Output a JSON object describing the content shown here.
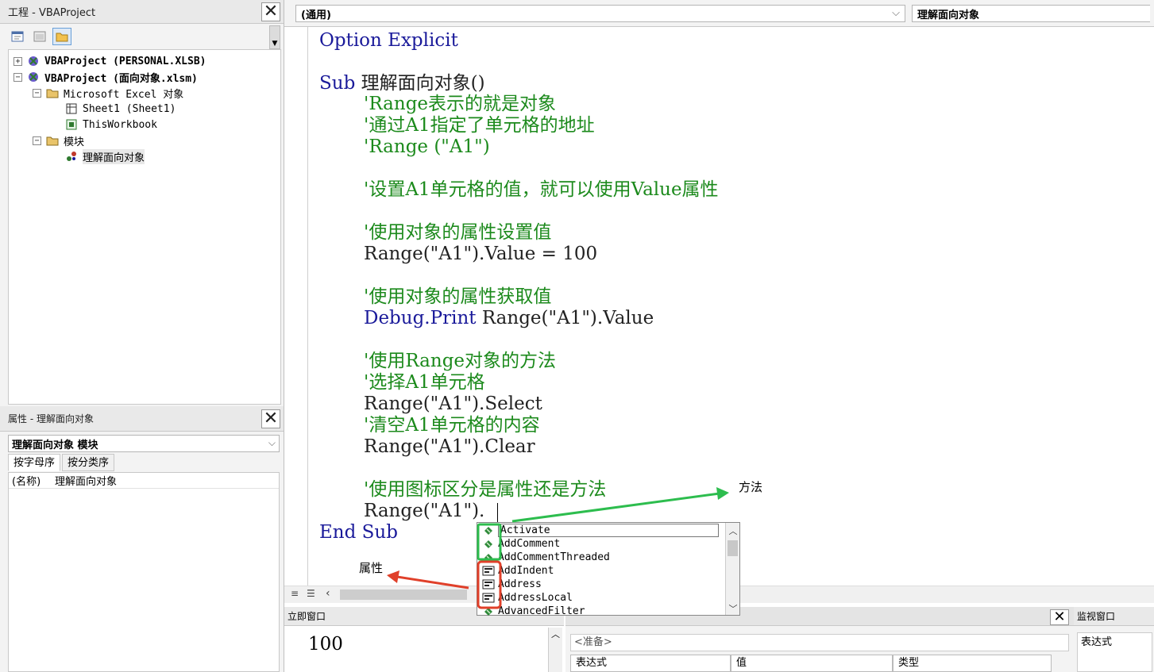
{
  "project_pane": {
    "title": "工程 - VBAProject",
    "tree": [
      {
        "label": "VBAProject (PERSONAL.XLSB)",
        "expander": "+",
        "bold": true
      },
      {
        "label": "VBAProject (面向对象.xlsm)",
        "expander": "−",
        "bold": true
      },
      {
        "label": "Microsoft Excel 对象",
        "expander": "−",
        "bold": false
      },
      {
        "label": "Sheet1 (Sheet1)",
        "expander": "",
        "bold": false
      },
      {
        "label": "ThisWorkbook",
        "expander": "",
        "bold": false
      },
      {
        "label": "模块",
        "expander": "−",
        "bold": false
      },
      {
        "label": "理解面向对象",
        "expander": "",
        "bold": false
      }
    ]
  },
  "properties_pane": {
    "title": "属性 - 理解面向对象",
    "object_select": "理解面向对象 模块",
    "tabs": [
      "按字母序",
      "按分类序"
    ],
    "rows": [
      {
        "name": "(名称)",
        "value": "理解面向对象"
      }
    ]
  },
  "code_window": {
    "object_dropdown": "(通用)",
    "procedure_dropdown": "理解面向对象",
    "lines": [
      {
        "text": "Option Explicit",
        "style": "kw"
      },
      {
        "text": "",
        "style": "tx"
      },
      {
        "text": "Sub 理解面向对象()",
        "style": "mix_sub"
      },
      {
        "text": "    'Range表示的就是对象",
        "style": "cm"
      },
      {
        "text": "    '通过A1指定了单元格的地址",
        "style": "cm"
      },
      {
        "text": "    'Range (\"A1\")",
        "style": "cm"
      },
      {
        "text": "",
        "style": "tx"
      },
      {
        "text": "    '设置A1单元格的值，就可以使用Value属性",
        "style": "cm"
      },
      {
        "text": "",
        "style": "tx"
      },
      {
        "text": "    '使用对象的属性设置值",
        "style": "cm"
      },
      {
        "text": "    Range(\"A1\").Value = 100",
        "style": "tx"
      },
      {
        "text": "",
        "style": "tx"
      },
      {
        "text": "    '使用对象的属性获取值",
        "style": "cm"
      },
      {
        "text": "    Debug.Print Range(\"A1\").Value",
        "style": "mix_debug"
      },
      {
        "text": "",
        "style": "tx"
      },
      {
        "text": "    '使用Range对象的方法",
        "style": "cm"
      },
      {
        "text": "    '选择A1单元格",
        "style": "cm"
      },
      {
        "text": "    Range(\"A1\").Select",
        "style": "tx"
      },
      {
        "text": "    '清空A1单元格的内容",
        "style": "cm"
      },
      {
        "text": "    Range(\"A1\").Clear",
        "style": "tx"
      },
      {
        "text": "",
        "style": "tx"
      },
      {
        "text": "    '使用图标区分是属性还是方法",
        "style": "cm"
      },
      {
        "text": "    Range(\"A1\").",
        "style": "tx"
      },
      {
        "text": "End Sub",
        "style": "kw"
      }
    ]
  },
  "autocomplete": {
    "items": [
      {
        "label": "Activate",
        "kind": "method"
      },
      {
        "label": "AddComment",
        "kind": "method"
      },
      {
        "label": "AddCommentThreaded",
        "kind": "method"
      },
      {
        "label": "AddIndent",
        "kind": "property"
      },
      {
        "label": "Address",
        "kind": "property"
      },
      {
        "label": "AddressLocal",
        "kind": "property"
      },
      {
        "label": "AdvancedFilter",
        "kind": "method"
      }
    ]
  },
  "annotations": {
    "method_label": "方法",
    "property_label": "属性",
    "method_color": "#2dbd4e",
    "property_color": "#e0402a"
  },
  "immediate_window": {
    "title": "立即窗口",
    "content": "100"
  },
  "locals_window": {
    "status": "<准备>",
    "columns": [
      "表达式",
      "值",
      "类型"
    ]
  },
  "watch_window": {
    "title": "监视窗口",
    "column": "表达式"
  },
  "colors": {
    "keyword": "#1a1a9a",
    "comment": "#1c8a1c",
    "text": "#222222"
  }
}
